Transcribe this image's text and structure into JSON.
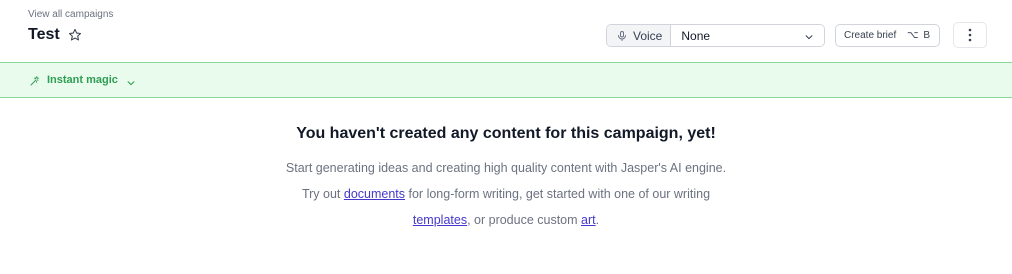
{
  "header": {
    "back_link": "View all campaigns",
    "title": "Test",
    "star_icon": "star-outline-icon"
  },
  "voice": {
    "label": "Voice",
    "icon": "microphone-icon",
    "selected": "None"
  },
  "create_brief": {
    "label": "Create brief",
    "shortcut": "⌥ B"
  },
  "more_menu": {
    "icon": "kebab-menu-icon"
  },
  "magic_bar": {
    "label": "Instant magic",
    "icon": "magic-wand-icon"
  },
  "empty_state": {
    "title": "You haven't created any content for this campaign, yet!",
    "text_1": "Start generating ideas and creating high quality content with Jasper's AI engine. Try out ",
    "link_documents": "documents",
    "text_2": " for long-form writing, get started with one of our writing ",
    "link_templates": "templates",
    "text_3": ", or produce custom ",
    "link_art": "art",
    "text_4": "."
  },
  "colors": {
    "accent_green": "#2f9e53",
    "magic_bar_bg": "#e8fbec",
    "link": "#4338ca"
  }
}
